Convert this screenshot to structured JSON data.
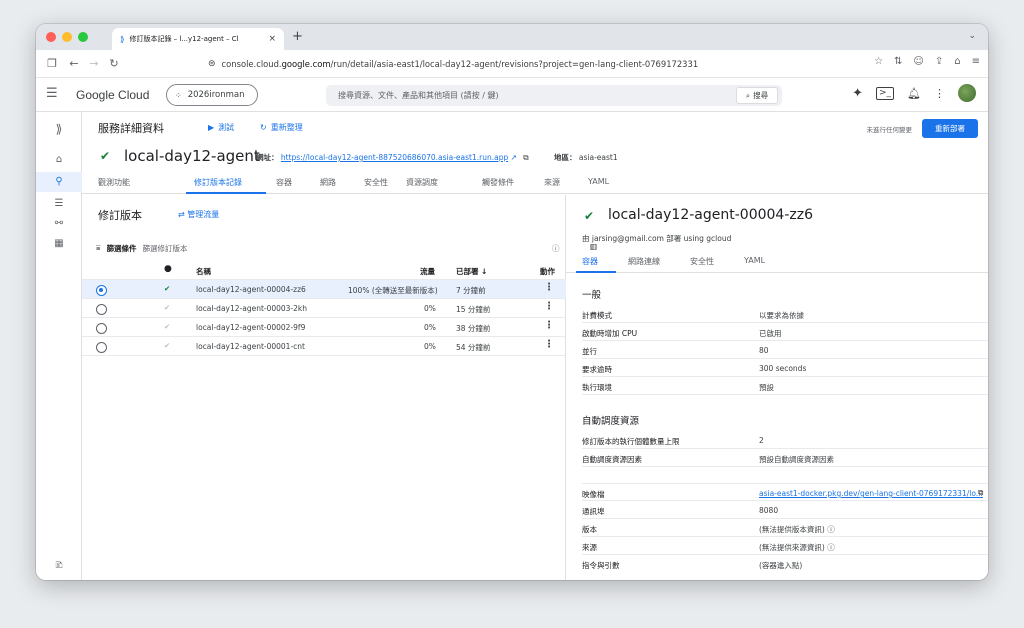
{
  "browser": {
    "tab_title": "修訂版本記錄 – l...y12-agent – Cl",
    "url_prefix": "console.cloud.",
    "url_domain": "google.com",
    "url_rest": "/run/detail/asia-east1/local-day12-agent/revisions?project=gen-lang-client-0769172331"
  },
  "header": {
    "brand": "Google Cloud",
    "project": "2026ironman",
    "search_placeholder": "搜尋資源、文件、產品和其他項目 (請按 / 鍵)",
    "search_button": "搜尋"
  },
  "page": {
    "title": "服務詳細資料",
    "test_label": "測試",
    "refresh_label": "重新整理",
    "unsaved_text": "未進行任何變更",
    "redeploy_label": "重新部署"
  },
  "service": {
    "name": "local-day12-agent",
    "url_label": "網址：",
    "url": "https://local-day12-agent-887520686070.asia-east1.run.app",
    "region_label": "地區：",
    "region": "asia-east1"
  },
  "tabs": [
    "觀測功能",
    "修訂版本記錄",
    "容器",
    "網路",
    "安全性",
    "資源調度",
    "觸發條件",
    "來源",
    "YAML"
  ],
  "revisions": {
    "title": "修訂版本",
    "manage_traffic": "管理流量",
    "filter_label": "篩選條件",
    "filter_placeholder": "篩選修訂版本",
    "columns": {
      "name": "名稱",
      "traffic": "流量",
      "deployed": "已部署",
      "actions": "動作"
    },
    "rows": [
      {
        "name": "local-day12-agent-00004-zz6",
        "traffic": "100% (全轉送至最新版本)",
        "deployed": "7 分鐘前"
      },
      {
        "name": "local-day12-agent-00003-2kh",
        "traffic": "0%",
        "deployed": "15 分鐘前"
      },
      {
        "name": "local-day12-agent-00002-9f9",
        "traffic": "0%",
        "deployed": "38 分鐘前"
      },
      {
        "name": "local-day12-agent-00001-cnt",
        "traffic": "0%",
        "deployed": "54 分鐘前"
      }
    ]
  },
  "detail": {
    "revision_name": "local-day12-agent-00004-zz6",
    "deployed_by": "由 jarsing@gmail.com 部署 using gcloud",
    "tabs": [
      "容器",
      "網路連線",
      "安全性",
      "YAML"
    ],
    "general_title": "一般",
    "general": [
      {
        "k": "計費模式",
        "v": "以要求為依據"
      },
      {
        "k": "啟動時增加 CPU",
        "v": "已啟用"
      },
      {
        "k": "並行",
        "v": "80"
      },
      {
        "k": "要求逾時",
        "v": "300 seconds"
      },
      {
        "k": "執行環境",
        "v": "預設"
      }
    ],
    "scaling_title": "自動調度資源",
    "scaling": [
      {
        "k": "修訂版本的執行個體數量上限",
        "v": "2"
      },
      {
        "k": "自動調度資源因素",
        "v": "預設自動調度資源因素"
      }
    ],
    "container": [
      {
        "k": "映像檔",
        "v": "asia-east1-docker.pkg.dev/gen-lang-client-0769172331/lo..."
      },
      {
        "k": "通訊埠",
        "v": "8080"
      },
      {
        "k": "版本",
        "v": "(無法提供版本資訊)"
      },
      {
        "k": "來源",
        "v": "(無法提供來源資訊)"
      },
      {
        "k": "指令與引數",
        "v": "(容器進入點)"
      }
    ]
  }
}
